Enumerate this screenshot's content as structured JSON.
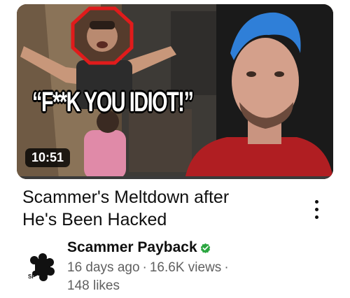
{
  "video": {
    "thumbnail_caption": "“F**K YOU IDIOT!”",
    "duration": "10:51",
    "title_line1": "Scammer's Meltdown after",
    "title_line2": "He's Been Hacked",
    "more_icon": "more-vert-icon"
  },
  "channel": {
    "name": "Scammer Payback",
    "avatar_text": "SP",
    "verified_icon": "verified-check-icon",
    "verified_color": "#2ba640"
  },
  "stats": {
    "age": "16 days ago",
    "separator": "·",
    "views": "16.6K views",
    "likes": "148 likes"
  },
  "colors": {
    "text_primary": "#0f0f0f",
    "text_secondary": "#606060",
    "highlight_red": "#e01b1b"
  }
}
